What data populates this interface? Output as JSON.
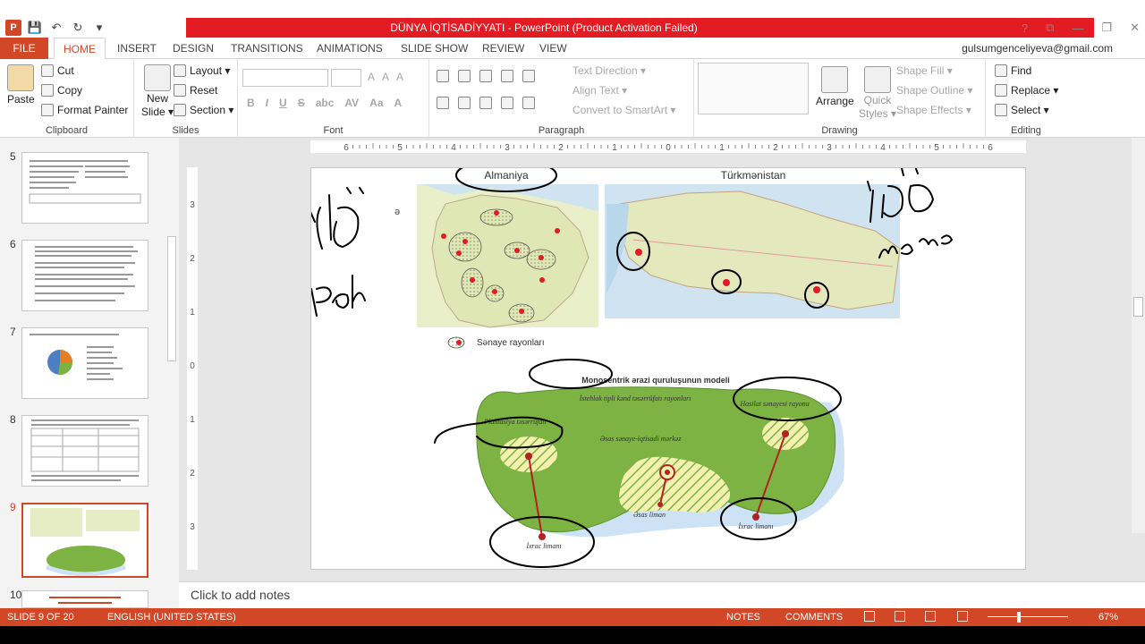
{
  "window": {
    "title": "DÜNYA İQTİSADİYYATI -  PowerPoint (Product Activation Failed)",
    "help": "?",
    "ribbon_opts": "⧉",
    "minimize": "—",
    "restore": "❐",
    "close": "✕"
  },
  "qat": {
    "logo": "P",
    "save": "💾",
    "undo": "↶",
    "redo": "↻",
    "customize": "▾"
  },
  "tabs": {
    "file": "FILE",
    "items": [
      "HOME",
      "INSERT",
      "DESIGN",
      "TRANSITIONS",
      "ANIMATIONS",
      "SLIDE SHOW",
      "REVIEW",
      "VIEW"
    ],
    "user": "gulsumgenceliyeva@gmail.com"
  },
  "ribbon": {
    "clipboard": {
      "label": "Clipboard",
      "paste": "Paste",
      "cut": "Cut",
      "copy": "Copy",
      "format_painter": "Format Painter"
    },
    "slides": {
      "label": "Slides",
      "new_slide_1": "New",
      "new_slide_2": "Slide ▾",
      "layout": "Layout ▾",
      "reset": "Reset",
      "section": "Section ▾"
    },
    "font": {
      "label": "Font",
      "bold": "B",
      "italic": "I",
      "underline": "U",
      "strike": "S",
      "shadow": "abc",
      "spacing": "AV",
      "case": "Aa",
      "color": "A",
      "grow": "A",
      "shrink": "A",
      "clear": "A"
    },
    "paragraph": {
      "label": "Paragraph",
      "text_direction": "Text Direction ▾",
      "align_text": "Align Text ▾",
      "convert_smartart": "Convert to SmartArt ▾"
    },
    "drawing": {
      "label": "Drawing",
      "arrange": "Arrange",
      "quick_styles_1": "Quick",
      "quick_styles_2": "Styles ▾",
      "shape_fill": "Shape Fill ▾",
      "shape_outline": "Shape Outline ▾",
      "shape_effects": "Shape Effects ▾"
    },
    "editing": {
      "label": "Editing",
      "find": "Find",
      "replace": "Replace ▾",
      "select": "Select ▾"
    }
  },
  "ruler": {
    "top_ticks": [
      "6",
      "5",
      "4",
      "3",
      "2",
      "1",
      "0",
      "1",
      "2",
      "3",
      "4",
      "5",
      "6"
    ],
    "left_ticks": [
      "3",
      "2",
      "1",
      "0",
      "1",
      "2",
      "3"
    ]
  },
  "slide_panel": {
    "numbers": [
      "5",
      "6",
      "7",
      "8",
      "9",
      "10"
    ],
    "selected": "9"
  },
  "slide": {
    "map1_title": "Almaniya",
    "map2_title": "Türkmənistan",
    "legend": "Sənaye rayonları",
    "model_title": "Monosentrik ərazi quruluşunun modeli",
    "zone_top": "İstehlak tipli kənd təsərrüfatı rayonları",
    "plantation": "Plantasiya təsərrüfatı",
    "mining": "Hasilat sənayesi rayonu",
    "center": "Əsas sənaye-iqtisadi mərkəz",
    "main_port": "Əsas liman",
    "export_port_1": "İxrac limanı",
    "export_port_2": "İxrac limanı",
    "stray_mark": "ə"
  },
  "notes": {
    "placeholder": "Click to add notes"
  },
  "status": {
    "slide": "SLIDE 9 OF 20",
    "language": "ENGLISH (UNITED STATES)",
    "notes": "NOTES",
    "comments": "COMMENTS",
    "zoom": "67%"
  },
  "colors": {
    "accent": "#d24726",
    "titlebar_red": "#e31b23",
    "land_green": "#7cb342",
    "sea_blue": "#cde3f5",
    "map_land": "#e6ecc4"
  }
}
